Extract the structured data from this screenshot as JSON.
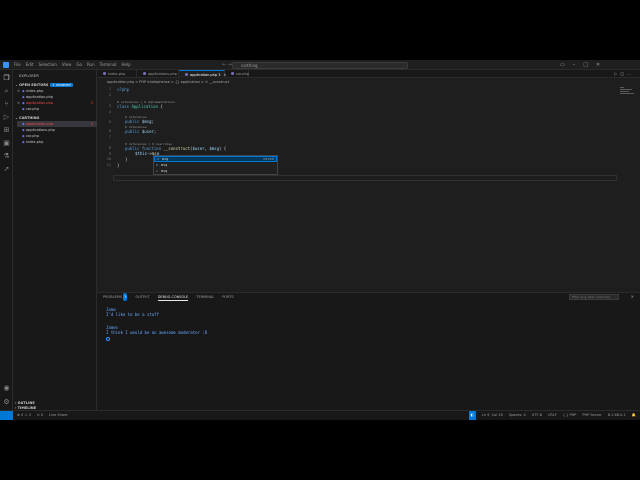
{
  "titlebar": {
    "menu": [
      "File",
      "Edit",
      "Selection",
      "View",
      "Go",
      "Run",
      "Terminal",
      "Help"
    ],
    "search": "carthing"
  },
  "sidebar": {
    "header": "EXPLORER",
    "open_editors": {
      "label": "OPEN EDITORS",
      "badge": "1 unsaved"
    },
    "open_files": [
      {
        "name": "index.php",
        "modified": false
      },
      {
        "name": "application.php",
        "modified": false
      },
      {
        "name": "application.php",
        "modified": true,
        "dot": "3"
      },
      {
        "name": "car.php",
        "modified": false
      }
    ],
    "project": {
      "label": "CARTHING"
    },
    "project_files": [
      {
        "name": "application.php",
        "modified": true,
        "dot": "3"
      },
      {
        "name": "applications.php",
        "modified": false
      },
      {
        "name": "car.php",
        "modified": false
      },
      {
        "name": "index.php",
        "modified": false
      }
    ],
    "outline": "OUTLINE",
    "timeline": "TIMELINE"
  },
  "tabs": [
    {
      "label": "index.php",
      "active": false
    },
    {
      "label": "applications.php",
      "active": false
    },
    {
      "label": "application.php 3",
      "active": true
    },
    {
      "label": "car.php",
      "active": false
    }
  ],
  "breadcrumb": "application.php > PHP Intelephense > {} application > ⊙ __construct",
  "editor": {
    "lines": [
      {
        "n": "1",
        "t": "<?php"
      },
      {
        "n": "2",
        "t": ""
      },
      {
        "lens": "0 references | 0 implementations"
      },
      {
        "n": "3",
        "t": "class Application {"
      },
      {
        "n": "4",
        "t": ""
      },
      {
        "lens": "0 references"
      },
      {
        "n": "5",
        "t": "public $msg;"
      },
      {
        "lens": "0 references"
      },
      {
        "n": "6",
        "t": "public $user;"
      },
      {
        "n": "7",
        "t": ""
      },
      {
        "lens": "0 references | 0 overrides"
      },
      {
        "n": "8",
        "t": "public function __construct($user, $msg) {"
      },
      {
        "n": "9",
        "t": "$this->msg"
      },
      {
        "n": "10",
        "t": "}"
      },
      {
        "n": "11",
        "t": "}"
      }
    ],
    "suggest": [
      {
        "label": "msg",
        "detail": "mixed",
        "selected": true
      },
      {
        "label": "msg",
        "detail": "",
        "selected": false
      },
      {
        "label": "msg",
        "detail": "",
        "selected": false
      }
    ]
  },
  "panel": {
    "tabs": [
      "PROBLEMS",
      "OUTPUT",
      "DEBUG CONSOLE",
      "TERMINAL",
      "PORTS"
    ],
    "problems_count": "3",
    "filter_placeholder": "Filter (e.g. text, !exclude)",
    "output": [
      "Jama",
      "I'd like to be a staff",
      "",
      "James",
      "I think I would be an awesome moderator :D"
    ]
  },
  "statusbar": {
    "left": [
      "⊗ 0 ⚠ 3",
      "⊙ 0",
      "Live Share"
    ],
    "right": [
      "Ln 9, Col 16",
      "Spaces: 4",
      "UTF-8",
      "CRLF",
      "{ } PHP",
      "PHP Server",
      "8.1.68.0.1"
    ]
  },
  "colors": {
    "accent": "#0078d4",
    "editor_bg": "#1e1e1e",
    "sidebar_bg": "#181818",
    "modified": "#f14c4c",
    "console_text": "#6aa7ff"
  }
}
